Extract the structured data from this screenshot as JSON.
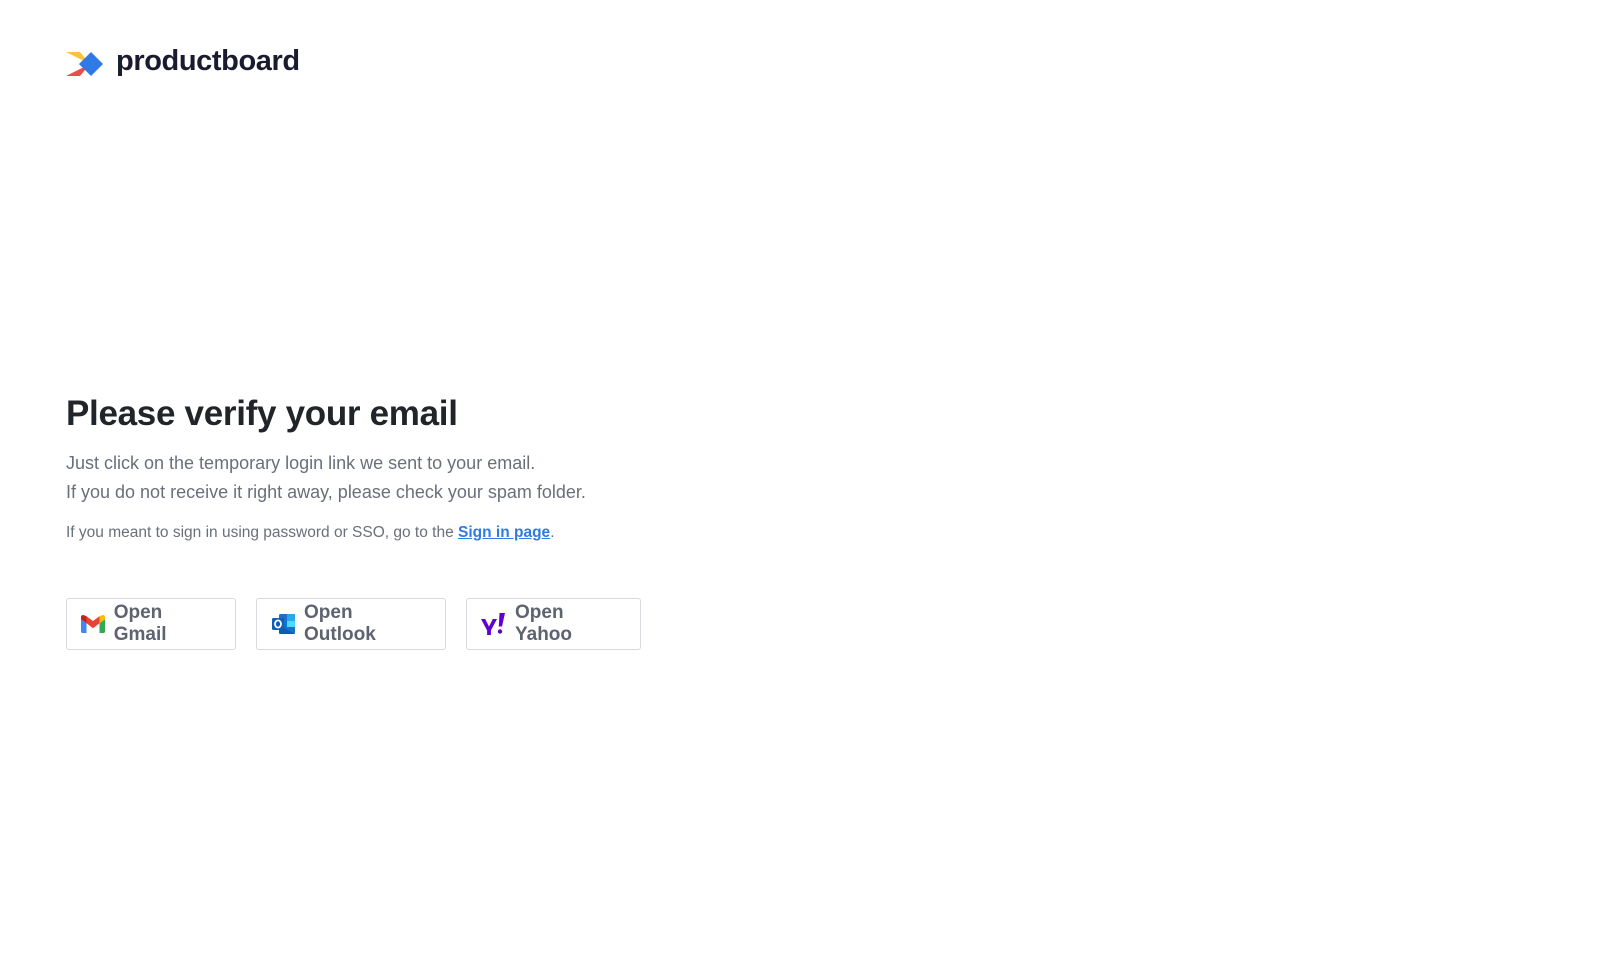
{
  "brand": {
    "name": "productboard",
    "logo_icon": "productboard-logo-icon"
  },
  "main": {
    "title": "Please verify your email",
    "description_line1": "Just click on the temporary login link we sent to your email.",
    "description_line2": "If you do not receive it right away, please check your spam folder.",
    "note_prefix": "If you meant to sign in using password or SSO, go to the ",
    "note_link": "Sign in page",
    "note_suffix": "."
  },
  "buttons": [
    {
      "label": "Open Gmail",
      "icon": "gmail-icon"
    },
    {
      "label": "Open Outlook",
      "icon": "outlook-icon"
    },
    {
      "label": "Open Yahoo",
      "icon": "yahoo-icon"
    }
  ],
  "colors": {
    "link": "#2f7ae5",
    "heading": "#212529",
    "body_text": "#6b6f7a",
    "yahoo_purple": "#6001d2",
    "outlook_blue": "#1e6fc8"
  }
}
